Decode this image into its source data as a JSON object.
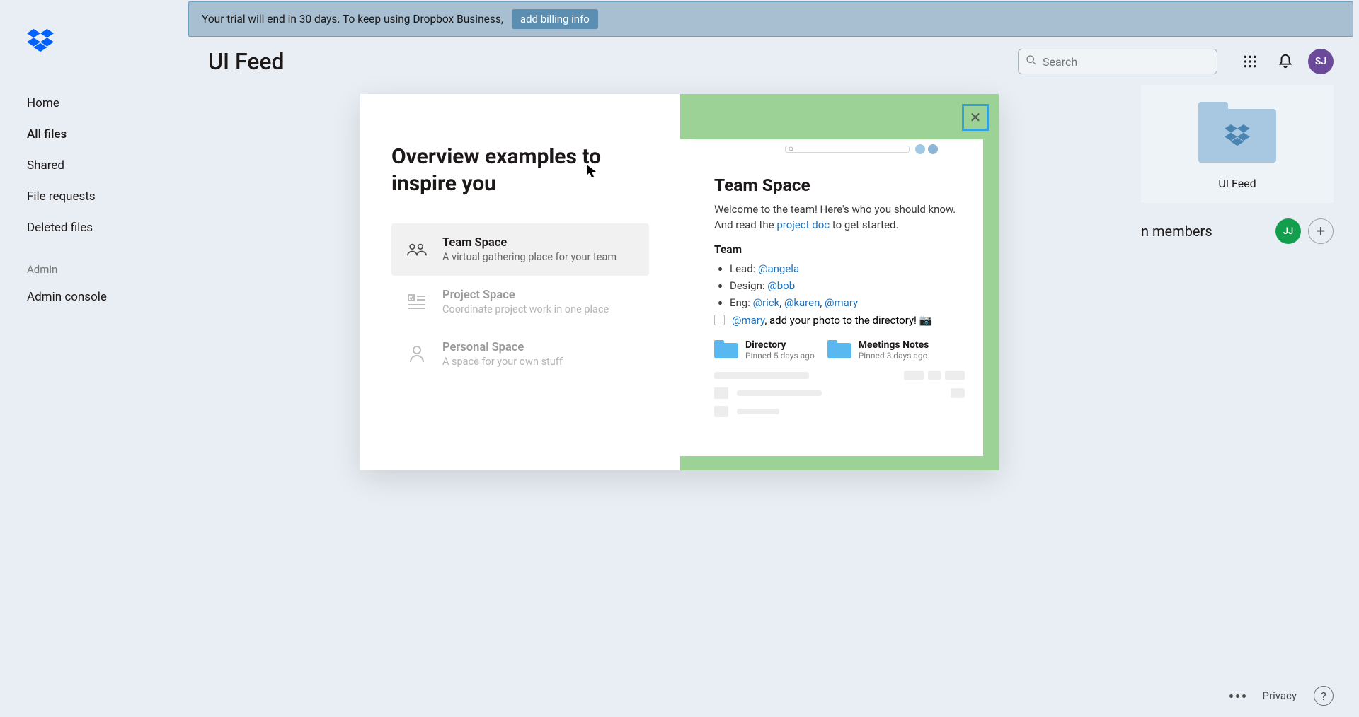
{
  "banner": {
    "message": "Your trial will end in 30 days. To keep using Dropbox Business,",
    "cta": "add billing info"
  },
  "header": {
    "page_title": "UI Feed",
    "search_placeholder": "Search",
    "avatar_initials": "SJ"
  },
  "sidebar": {
    "items": [
      {
        "label": "Home"
      },
      {
        "label": "All files"
      },
      {
        "label": "Shared"
      },
      {
        "label": "File requests"
      },
      {
        "label": "Deleted files"
      }
    ],
    "admin_section_label": "Admin",
    "admin_items": [
      {
        "label": "Admin console"
      }
    ]
  },
  "team_card": {
    "name": "UI Feed",
    "members_label": "members",
    "members_truncated_prefix": "n",
    "member_initials": "JJ",
    "add_symbol": "+"
  },
  "footer": {
    "privacy": "Privacy",
    "help": "?"
  },
  "modal": {
    "title": "Overview examples to inspire you",
    "close_symbol": "✕",
    "examples": [
      {
        "name": "Team Space",
        "desc": "A virtual gathering place for your team"
      },
      {
        "name": "Project Space",
        "desc": "Coordinate project work in one place"
      },
      {
        "name": "Personal Space",
        "desc": "A space for your own stuff"
      }
    ],
    "doc": {
      "title": "Team Space",
      "welcome_prefix": "Welcome to the team! Here's who you should know. And read the ",
      "welcome_link": "project doc",
      "welcome_suffix": " to get started.",
      "team_heading": "Team",
      "roles": {
        "lead_label": "Lead: ",
        "lead_handle": "@angela",
        "design_label": "Design: ",
        "design_handle": "@bob",
        "eng_label": "Eng: ",
        "eng_handles": [
          "@rick",
          "@karen",
          "@mary"
        ]
      },
      "todo_handle": "@mary",
      "todo_suffix": ", add your photo to the directory! ",
      "todo_emoji": "📷",
      "pinned": [
        {
          "name": "Directory",
          "meta": "Pinned 5 days ago"
        },
        {
          "name": "Meetings Notes",
          "meta": "Pinned 3 days ago"
        }
      ]
    }
  }
}
